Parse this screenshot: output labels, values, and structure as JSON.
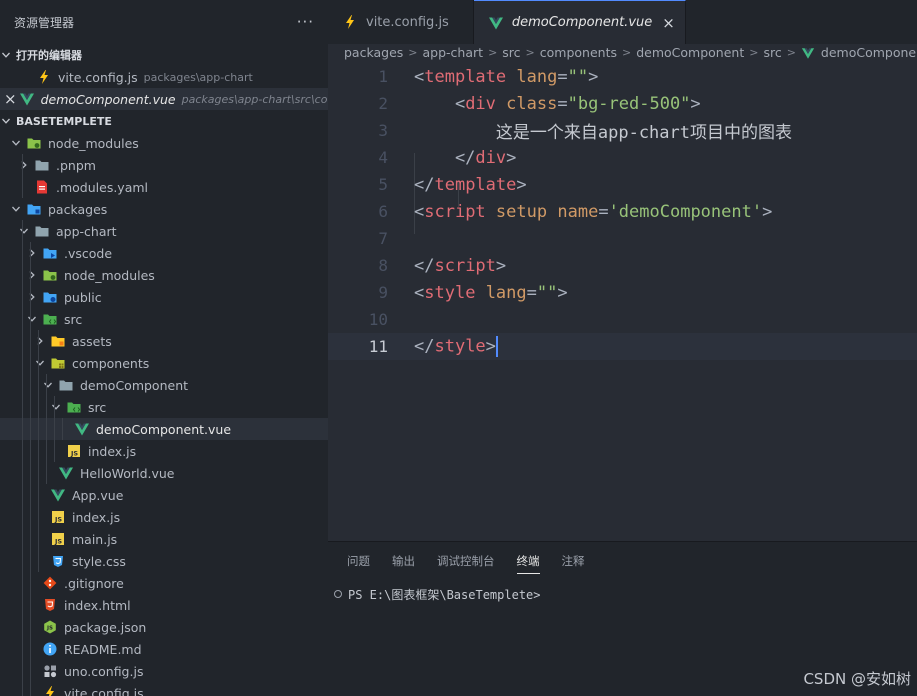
{
  "sidebar": {
    "title": "资源管理器",
    "more": "···",
    "open_editors_label": "打开的编辑器",
    "open_editors": [
      {
        "name": "vite.config.js",
        "path": "packages\\app-chart",
        "icon": "vite-icon",
        "closable": false
      },
      {
        "name": "demoComponent.vue",
        "path": "packages\\app-chart\\src\\co...",
        "icon": "vue-icon",
        "closable": true,
        "close": "×"
      }
    ],
    "project_label": "BASETEMPLETE",
    "tree": [
      {
        "label": "node_modules",
        "depth": 1,
        "chevron": "down",
        "icon": "folder-green-icon"
      },
      {
        "label": ".pnpm",
        "depth": 2,
        "chevron": "right",
        "icon": "folder-icon"
      },
      {
        "label": ".modules.yaml",
        "depth": 2,
        "chevron": "",
        "icon": "yaml-icon"
      },
      {
        "label": "packages",
        "depth": 1,
        "chevron": "down",
        "icon": "folder-blue-icon"
      },
      {
        "label": "app-chart",
        "depth": 2,
        "chevron": "down",
        "icon": "folder-open-icon"
      },
      {
        "label": ".vscode",
        "depth": 3,
        "chevron": "right",
        "icon": "folder-vscode-icon"
      },
      {
        "label": "node_modules",
        "depth": 3,
        "chevron": "right",
        "icon": "folder-green-icon"
      },
      {
        "label": "public",
        "depth": 3,
        "chevron": "right",
        "icon": "folder-globe-icon"
      },
      {
        "label": "src",
        "depth": 3,
        "chevron": "down",
        "icon": "folder-src-icon"
      },
      {
        "label": "assets",
        "depth": 4,
        "chevron": "right",
        "icon": "folder-yellow-icon"
      },
      {
        "label": "components",
        "depth": 4,
        "chevron": "down",
        "icon": "folder-components-icon"
      },
      {
        "label": "demoComponent",
        "depth": 5,
        "chevron": "down",
        "icon": "folder-open-icon"
      },
      {
        "label": "src",
        "depth": 6,
        "chevron": "down",
        "icon": "folder-src-icon"
      },
      {
        "label": "demoComponent.vue",
        "depth": 7,
        "chevron": "",
        "icon": "vue-icon",
        "selected": true
      },
      {
        "label": "index.js",
        "depth": 6,
        "chevron": "",
        "icon": "js-icon"
      },
      {
        "label": "HelloWorld.vue",
        "depth": 5,
        "chevron": "",
        "icon": "vue-icon"
      },
      {
        "label": "App.vue",
        "depth": 4,
        "chevron": "",
        "icon": "vue-icon"
      },
      {
        "label": "index.js",
        "depth": 4,
        "chevron": "",
        "icon": "js-icon"
      },
      {
        "label": "main.js",
        "depth": 4,
        "chevron": "",
        "icon": "js-icon"
      },
      {
        "label": "style.css",
        "depth": 4,
        "chevron": "",
        "icon": "css-icon"
      },
      {
        "label": ".gitignore",
        "depth": 3,
        "chevron": "",
        "icon": "git-icon"
      },
      {
        "label": "index.html",
        "depth": 3,
        "chevron": "",
        "icon": "html-icon"
      },
      {
        "label": "package.json",
        "depth": 3,
        "chevron": "",
        "icon": "nodejs-icon"
      },
      {
        "label": "README.md",
        "depth": 3,
        "chevron": "",
        "icon": "info-icon"
      },
      {
        "label": "uno.config.js",
        "depth": 3,
        "chevron": "",
        "icon": "uno-icon"
      },
      {
        "label": "vite.config.js",
        "depth": 3,
        "chevron": "",
        "icon": "vite-icon"
      }
    ]
  },
  "tabs": [
    {
      "label": "vite.config.js",
      "icon": "vite-icon",
      "active": false
    },
    {
      "label": "demoComponent.vue",
      "icon": "vue-icon",
      "active": true,
      "close": "×"
    }
  ],
  "breadcrumb": {
    "items": [
      "packages",
      "app-chart",
      "src",
      "components",
      "demoComponent",
      "src"
    ],
    "file": "demoComponent.vue",
    "separator": ">"
  },
  "code": {
    "current_line": 11,
    "lines": [
      {
        "n": "1",
        "tokens": [
          [
            "punc",
            "<"
          ],
          [
            "tag",
            "template"
          ],
          [
            "punc",
            " "
          ],
          [
            "attr",
            "lang"
          ],
          [
            "punc",
            "="
          ],
          [
            "str",
            "\"\""
          ],
          [
            "punc",
            ">"
          ]
        ]
      },
      {
        "n": "2",
        "tokens": [
          [
            "punc",
            "    <"
          ],
          [
            "tag",
            "div"
          ],
          [
            "punc",
            " "
          ],
          [
            "attr",
            "class"
          ],
          [
            "punc",
            "="
          ],
          [
            "str",
            "\"bg-red-500\""
          ],
          [
            "punc",
            ">"
          ]
        ]
      },
      {
        "n": "3",
        "tokens": [
          [
            "text",
            "        这是一个来自app-chart项目中的图表"
          ]
        ]
      },
      {
        "n": "4",
        "tokens": [
          [
            "punc",
            "    </"
          ],
          [
            "tag",
            "div"
          ],
          [
            "punc",
            ">"
          ]
        ]
      },
      {
        "n": "5",
        "tokens": [
          [
            "punc",
            "</"
          ],
          [
            "tag",
            "template"
          ],
          [
            "punc",
            ">"
          ]
        ]
      },
      {
        "n": "6",
        "tokens": [
          [
            "punc",
            "<"
          ],
          [
            "tag",
            "script"
          ],
          [
            "punc",
            " "
          ],
          [
            "attr",
            "setup"
          ],
          [
            "punc",
            " "
          ],
          [
            "attr",
            "name"
          ],
          [
            "punc",
            "="
          ],
          [
            "str",
            "'demoComponent'"
          ],
          [
            "punc",
            ">"
          ]
        ]
      },
      {
        "n": "7",
        "tokens": []
      },
      {
        "n": "8",
        "tokens": [
          [
            "punc",
            "</"
          ],
          [
            "tag",
            "script"
          ],
          [
            "punc",
            ">"
          ]
        ]
      },
      {
        "n": "9",
        "tokens": [
          [
            "punc",
            "<"
          ],
          [
            "tag",
            "style"
          ],
          [
            "punc",
            " "
          ],
          [
            "attr",
            "lang"
          ],
          [
            "punc",
            "="
          ],
          [
            "str",
            "\"\""
          ],
          [
            "punc",
            ">"
          ]
        ]
      },
      {
        "n": "10",
        "tokens": []
      },
      {
        "n": "11",
        "tokens": [
          [
            "punc",
            "</"
          ],
          [
            "tag",
            "style"
          ],
          [
            "punc",
            ">"
          ]
        ],
        "cursor": true
      }
    ]
  },
  "panel": {
    "tabs": [
      {
        "label": "问题",
        "active": false
      },
      {
        "label": "输出",
        "active": false
      },
      {
        "label": "调试控制台",
        "active": false
      },
      {
        "label": "终端",
        "active": true
      },
      {
        "label": "注释",
        "active": false
      }
    ],
    "terminal_prompt": "PS E:\\图表框架\\BaseTemplete>"
  },
  "watermark": "CSDN @安如树",
  "colors": {
    "accent": "#528bff",
    "vue": "#41b883",
    "tag": "#e06c75",
    "attr": "#d19a66",
    "string": "#98c379"
  }
}
